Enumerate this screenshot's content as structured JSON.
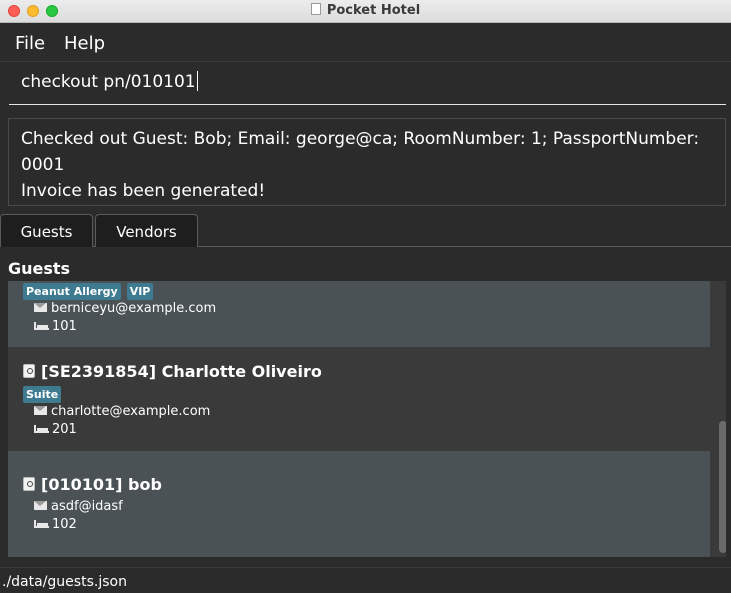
{
  "window": {
    "title": "Pocket Hotel"
  },
  "menu": {
    "file": "File",
    "help": "Help"
  },
  "command": {
    "value": "checkout pn/010101"
  },
  "result": {
    "line1": "Checked out Guest: Bob; Email: george@ca; RoomNumber: 1; PassportNumber: 0001",
    "line2": "Invoice has been generated!"
  },
  "tabs": [
    {
      "label": "Guests"
    },
    {
      "label": "Vendors"
    }
  ],
  "panel": {
    "title": "Guests"
  },
  "guests": [
    {
      "passport": "",
      "name": "",
      "tags": [
        "Peanut Allergy",
        "VIP"
      ],
      "email": "berniceyu@example.com",
      "room": "101"
    },
    {
      "passport": "[SE2391854]",
      "name": "Charlotte Oliveiro",
      "tags": [
        "Suite"
      ],
      "email": "charlotte@example.com",
      "room": "201"
    },
    {
      "passport": "[010101]",
      "name": "bob",
      "tags": [],
      "email": "asdf@idasf",
      "room": "102"
    }
  ],
  "status": {
    "path": "./data/guests.json"
  },
  "colors": {
    "tag": "#3e7b91",
    "card_alt": "#4a5255",
    "background": "#2b2b2b"
  },
  "icons": {
    "passport": "passport-icon",
    "email": "mail-icon",
    "room": "bed-icon"
  }
}
